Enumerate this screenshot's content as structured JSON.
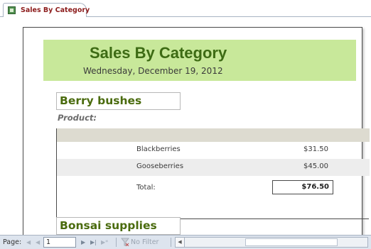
{
  "tab": {
    "label": "Sales By Category",
    "icon": "report-icon"
  },
  "report": {
    "title": "Sales By Category",
    "date": "Wednesday, December 19, 2012",
    "header_color": "#c8e89a",
    "title_color": "#3d6b14"
  },
  "groups": [
    {
      "category": "Berry bushes",
      "product_label": "Product:",
      "rows": [
        {
          "product": "Blackberries",
          "price": "$31.50"
        },
        {
          "product": "Gooseberries",
          "price": "$45.00"
        }
      ],
      "total_label": "Total:",
      "total_value": "$76.50"
    },
    {
      "category": "Bonsai supplies"
    }
  ],
  "statusbar": {
    "page_label": "Page:",
    "page_value": "1",
    "filter_label": "No Filter",
    "nav_icons": [
      "first-record-icon",
      "previous-record-icon",
      "next-record-icon",
      "last-record-icon",
      "new-record-icon"
    ]
  }
}
